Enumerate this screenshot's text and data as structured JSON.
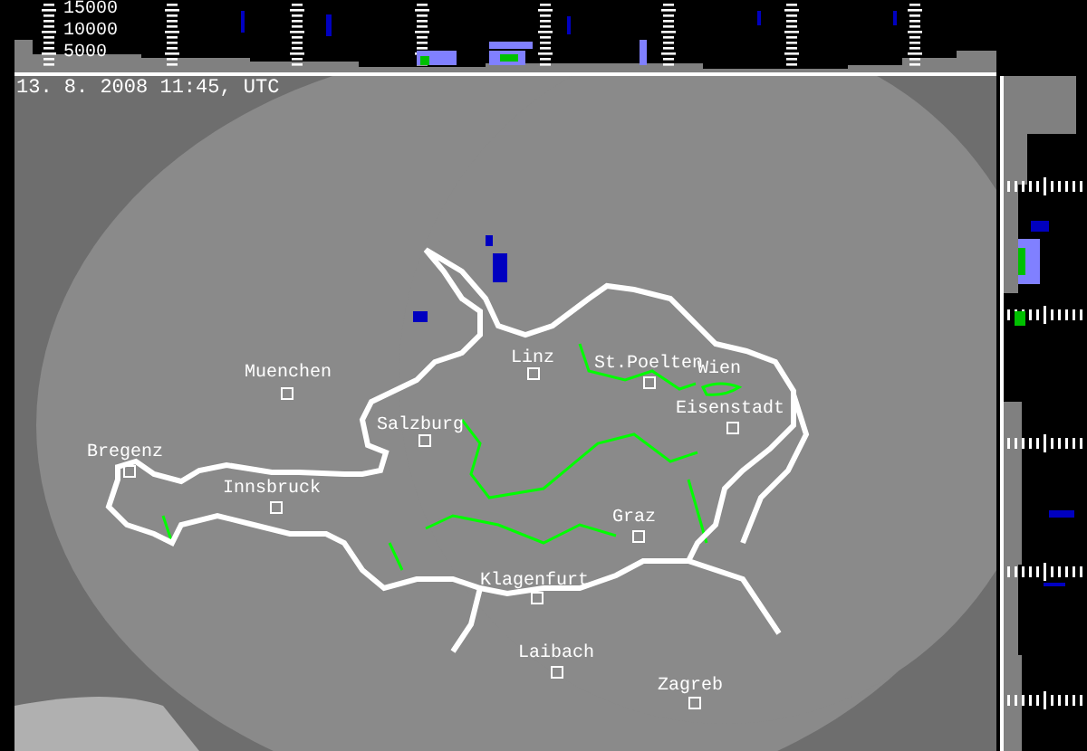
{
  "altitude_labels": [
    "15000",
    "10000",
    "5000"
  ],
  "timestamp": "13. 8. 2008 11:45, UTC",
  "cities": [
    {
      "name": "Muenchen",
      "has_marker": true
    },
    {
      "name": "Bregenz",
      "has_marker": true
    },
    {
      "name": "Innsbruck",
      "has_marker": true
    },
    {
      "name": "Salzburg",
      "has_marker": true
    },
    {
      "name": "Linz",
      "has_marker": true
    },
    {
      "name": "St.Poelten",
      "has_marker": true
    },
    {
      "name": "Wien",
      "has_marker": false
    },
    {
      "name": "Eisenstadt",
      "has_marker": true
    },
    {
      "name": "Graz",
      "has_marker": true
    },
    {
      "name": "Klagenfurt",
      "has_marker": true
    },
    {
      "name": "Laibach",
      "has_marker": true
    },
    {
      "name": "Zagreb",
      "has_marker": true
    }
  ]
}
